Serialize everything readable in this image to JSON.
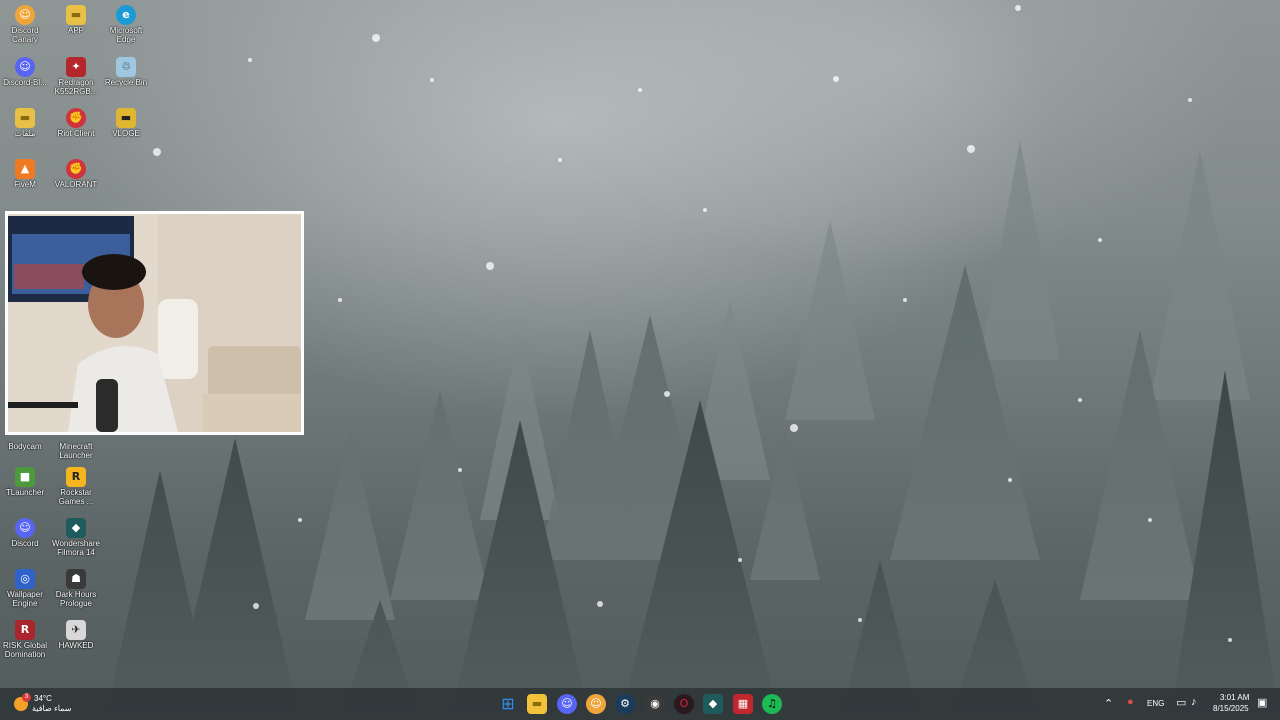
{
  "desktop": {
    "icons": [
      {
        "label": "Discord Canary",
        "glyph": "☺",
        "color": "#f0a53b"
      },
      {
        "label": "APP",
        "glyph": "▬",
        "color": "#e9c046"
      },
      {
        "label": "Microsoft Edge",
        "glyph": "e",
        "color": "#1b9ad6"
      },
      {
        "label": "Discord-Bl...",
        "glyph": "☺",
        "color": "#5865f2"
      },
      {
        "label": "Redragon K552RGB...",
        "glyph": "✦",
        "color": "#b3262b"
      },
      {
        "label": "Recycle Bin",
        "glyph": "♲",
        "color": "#9fc7df"
      },
      {
        "label": "ملفات",
        "glyph": "▬",
        "color": "#e9c046"
      },
      {
        "label": "Riot Client",
        "glyph": "✊",
        "color": "#d1333d"
      },
      {
        "label": "VLOGE",
        "glyph": "▬",
        "color": "#e0b530"
      },
      {
        "label": "FiveM",
        "glyph": "▲",
        "color": "#f07a21"
      },
      {
        "label": "VALORANT",
        "glyph": "✊",
        "color": "#d1333d"
      },
      {
        "label": "Bodycam",
        "glyph": "◉",
        "color": "#3b3b3b"
      },
      {
        "label": "Minecraft Launcher",
        "glyph": "■",
        "color": "#5b8f3a"
      },
      {
        "label": "TLauncher",
        "glyph": "■",
        "color": "#4c9a3c"
      },
      {
        "label": "Rockstar Games ...",
        "glyph": "R",
        "color": "#f4b51e"
      },
      {
        "label": "Discord",
        "glyph": "☺",
        "color": "#5865f2"
      },
      {
        "label": "Wondershare Filmora 14",
        "glyph": "◆",
        "color": "#1e5b5d"
      },
      {
        "label": "Wallpaper Engine",
        "glyph": "◎",
        "color": "#2f63c9"
      },
      {
        "label": "Dark Hours Prologue",
        "glyph": "☗",
        "color": "#3a3a3a"
      },
      {
        "label": "RISK Global Domination",
        "glyph": "R",
        "color": "#a9262c"
      },
      {
        "label": "HAWKED",
        "glyph": "✈",
        "color": "#d8d8d8"
      }
    ]
  },
  "taskbar": {
    "weather": {
      "temp": "34°C",
      "condition": "سماء صافية",
      "badge": "3"
    },
    "apps": [
      {
        "name": "start-button",
        "glyph": "⊞",
        "color": "#2b8ff0"
      },
      {
        "name": "file-explorer",
        "glyph": "▬",
        "color": "#f2c23a"
      },
      {
        "name": "discord",
        "glyph": "☺",
        "color": "#5865f2"
      },
      {
        "name": "discord-canary",
        "glyph": "☺",
        "color": "#f0a53b"
      },
      {
        "name": "steam",
        "glyph": "⚙",
        "color": "#1b3b5c"
      },
      {
        "name": "obs",
        "glyph": "◉",
        "color": "#3a3a3a"
      },
      {
        "name": "opera-gx",
        "glyph": "O",
        "color": "#e0203f"
      },
      {
        "name": "filmora",
        "glyph": "◆",
        "color": "#1e5b5d"
      },
      {
        "name": "hawked-game",
        "glyph": "▦",
        "color": "#c1272d"
      },
      {
        "name": "spotify",
        "glyph": "♫",
        "color": "#1db954"
      }
    ],
    "tray": {
      "language": "ENG",
      "time": "3:01 AM",
      "date": "8/15/2025"
    }
  }
}
